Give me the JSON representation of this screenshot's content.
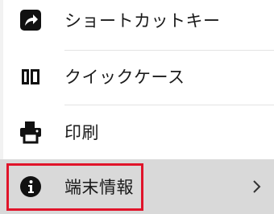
{
  "menu": {
    "items": [
      {
        "label": "ショートカットキー",
        "icon": "share-arrow-icon"
      },
      {
        "label": "クイックケース",
        "icon": "book-icon"
      },
      {
        "label": "印刷",
        "icon": "printer-icon"
      },
      {
        "label": "端末情報",
        "icon": "info-icon",
        "selected": true,
        "has_chevron": true
      }
    ]
  },
  "colors": {
    "highlight_border": "#e0142a",
    "selected_background": "#d9d9d9",
    "icon": "#111111",
    "text": "#1a1a1a"
  }
}
